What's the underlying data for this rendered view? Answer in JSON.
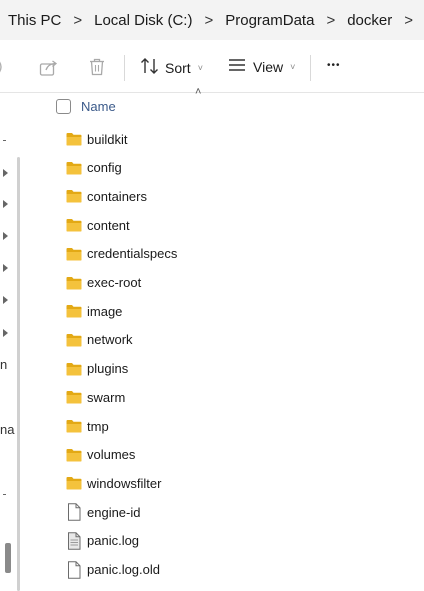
{
  "breadcrumb": {
    "items": [
      "This PC",
      "Local Disk (C:)",
      "ProgramData",
      "docker"
    ],
    "separator": ">"
  },
  "toolbar": {
    "sort_label": "Sort",
    "view_label": "View",
    "more_label": "•••",
    "dropdown_glyph": "˅"
  },
  "nav": {
    "fragments": [
      "n",
      "na"
    ]
  },
  "list": {
    "column_name": "Name",
    "sort_indicator": "˄",
    "items": [
      {
        "name": "buildkit",
        "type": "folder"
      },
      {
        "name": "config",
        "type": "folder"
      },
      {
        "name": "containers",
        "type": "folder"
      },
      {
        "name": "content",
        "type": "folder"
      },
      {
        "name": "credentialspecs",
        "type": "folder"
      },
      {
        "name": "exec-root",
        "type": "folder"
      },
      {
        "name": "image",
        "type": "folder"
      },
      {
        "name": "network",
        "type": "folder"
      },
      {
        "name": "plugins",
        "type": "folder"
      },
      {
        "name": "swarm",
        "type": "folder"
      },
      {
        "name": "tmp",
        "type": "folder"
      },
      {
        "name": "volumes",
        "type": "folder"
      },
      {
        "name": "windowsfilter",
        "type": "folder"
      },
      {
        "name": "engine-id",
        "type": "file"
      },
      {
        "name": "panic.log",
        "type": "log"
      },
      {
        "name": "panic.log.old",
        "type": "file"
      }
    ]
  },
  "colors": {
    "folder": "#f4c23c",
    "folder_dark": "#e3a915",
    "header_text": "#3b5a8a",
    "breadcrumb_bg": "#f3f3f3"
  }
}
